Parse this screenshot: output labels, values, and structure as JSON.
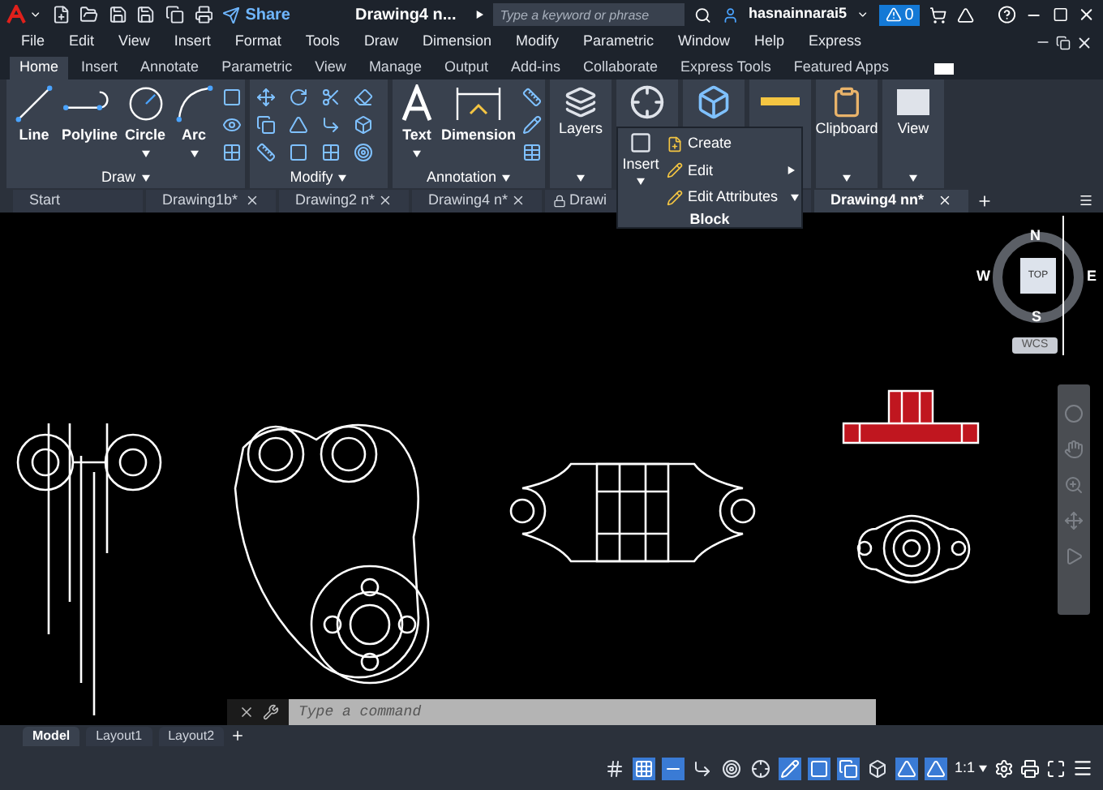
{
  "title_bar": {
    "share": "Share",
    "title": "Drawing4 n...",
    "search": {
      "placeholder": "Type a keyword or phrase"
    },
    "user": "hasnainnarai5",
    "alerts": "0"
  },
  "menu": [
    "File",
    "Edit",
    "View",
    "Insert",
    "Format",
    "Tools",
    "Draw",
    "Dimension",
    "Modify",
    "Parametric",
    "Window",
    "Help",
    "Express"
  ],
  "ribbon_tabs": [
    {
      "label": "Home",
      "selected": true
    },
    {
      "label": "Insert",
      "selected": false
    },
    {
      "label": "Annotate",
      "selected": false
    },
    {
      "label": "Parametric",
      "selected": false
    },
    {
      "label": "View",
      "selected": false
    },
    {
      "label": "Manage",
      "selected": false
    },
    {
      "label": "Output",
      "selected": false
    },
    {
      "label": "Add-ins",
      "selected": false
    },
    {
      "label": "Collaborate",
      "selected": false
    },
    {
      "label": "Express Tools",
      "selected": false
    },
    {
      "label": "Featured Apps",
      "selected": false
    }
  ],
  "ribbon": {
    "draw": {
      "title": "Draw",
      "tools": [
        "Line",
        "Polyline",
        "Circle",
        "Arc"
      ]
    },
    "modify": {
      "title": "Modify"
    },
    "annotation": {
      "title": "Annotation",
      "tools": [
        "Text",
        "Dimension"
      ]
    },
    "layers": "Layers",
    "clipboard": "Clipboard",
    "view": "View"
  },
  "block_menu": {
    "button": "Insert",
    "items": [
      "Create",
      "Edit",
      "Edit Attributes"
    ],
    "title": "Block"
  },
  "doc_tabs": [
    {
      "label": "Start",
      "selected": false,
      "locked": false
    },
    {
      "label": "Drawing1b*",
      "selected": false,
      "locked": false
    },
    {
      "label": "Drawing2 n*",
      "selected": false,
      "locked": false
    },
    {
      "label": "Drawing4 n*",
      "selected": false,
      "locked": false
    },
    {
      "label": "Drawi",
      "selected": false,
      "locked": true
    },
    {
      "label": "Drawing4 nn*",
      "selected": true,
      "locked": false
    }
  ],
  "viewcube": {
    "north": "N",
    "south": "S",
    "east": "E",
    "west": "W",
    "face": "TOP",
    "ucs": "WCS"
  },
  "command_line": {
    "placeholder": "Type a command"
  },
  "layout_tabs": [
    {
      "label": "Model",
      "selected": true
    },
    {
      "label": "Layout1",
      "selected": false
    },
    {
      "label": "Layout2",
      "selected": false
    }
  ],
  "status_bar": {
    "scale": "1:1",
    "toggles": [
      {
        "on": false
      },
      {
        "on": true
      },
      {
        "on": true
      },
      {
        "on": false
      },
      {
        "on": false
      },
      {
        "on": false
      },
      {
        "on": true
      },
      {
        "on": true
      },
      {
        "on": true
      },
      {
        "on": false
      },
      {
        "on": true
      },
      {
        "on": true
      }
    ]
  }
}
